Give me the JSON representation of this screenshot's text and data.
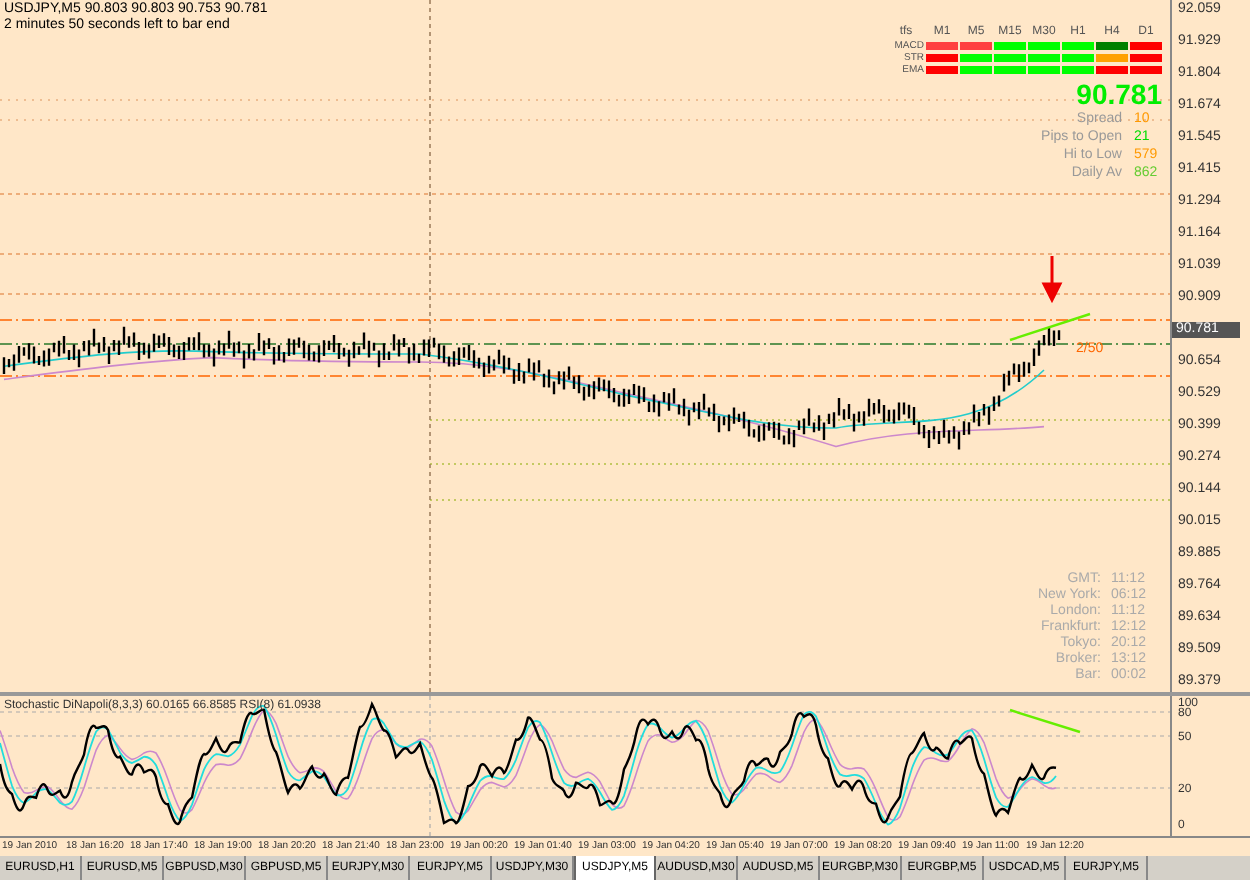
{
  "header": {
    "quote": "USDJPY,M5  90.803 90.803 90.753 90.781",
    "timer": "2 minutes 50 seconds left to bar end"
  },
  "price_axis": {
    "ticks": [
      {
        "label": "92.059",
        "current": false
      },
      {
        "label": "91.929",
        "current": false
      },
      {
        "label": "91.804",
        "current": false
      },
      {
        "label": "91.674",
        "current": false
      },
      {
        "label": "91.545",
        "current": false
      },
      {
        "label": "91.415",
        "current": false
      },
      {
        "label": "91.294",
        "current": false
      },
      {
        "label": "91.164",
        "current": false
      },
      {
        "label": "91.039",
        "current": false
      },
      {
        "label": "90.909",
        "current": false
      },
      {
        "label": "90.781",
        "current": true
      },
      {
        "label": "90.654",
        "current": false
      },
      {
        "label": "90.529",
        "current": false
      },
      {
        "label": "90.399",
        "current": false
      },
      {
        "label": "90.274",
        "current": false
      },
      {
        "label": "90.144",
        "current": false
      },
      {
        "label": "90.015",
        "current": false
      },
      {
        "label": "89.885",
        "current": false
      },
      {
        "label": "89.764",
        "current": false
      },
      {
        "label": "89.634",
        "current": false
      },
      {
        "label": "89.509",
        "current": false
      },
      {
        "label": "89.379",
        "current": false
      }
    ]
  },
  "signal_panel": {
    "corner": "tfs",
    "timeframes": [
      "M1",
      "M5",
      "M15",
      "M30",
      "H1",
      "H4",
      "D1"
    ],
    "rows": [
      {
        "name": "MACD",
        "cells": [
          {
            "color": "#ff4040"
          },
          {
            "color": "#ff4040"
          },
          {
            "color": "#00ff00"
          },
          {
            "color": "#00ff00"
          },
          {
            "color": "#00ff00"
          },
          {
            "color": "#008000"
          },
          {
            "color": "#ff0000"
          }
        ]
      },
      {
        "name": "STR",
        "cells": [
          {
            "color": "#ff0000"
          },
          {
            "color": "#00ff00"
          },
          {
            "color": "#00ff00"
          },
          {
            "color": "#00ff00"
          },
          {
            "color": "#00ff00"
          },
          {
            "color": "#ffa000"
          },
          {
            "color": "#ff0000"
          }
        ]
      },
      {
        "name": "EMA",
        "cells": [
          {
            "color": "#ff0000"
          },
          {
            "color": "#00ff00"
          },
          {
            "color": "#00ff00"
          },
          {
            "color": "#00ff00"
          },
          {
            "color": "#00ff00"
          },
          {
            "color": "#ff0000"
          },
          {
            "color": "#ff0000"
          }
        ]
      }
    ]
  },
  "stats": {
    "price": "90.781",
    "rows": [
      {
        "label": "Spread",
        "value": "10",
        "color": "#ff9900"
      },
      {
        "label": "Pips to Open",
        "value": "21",
        "color": "#00dd00"
      },
      {
        "label": "Hi to Low",
        "value": "579",
        "color": "#ff9900"
      },
      {
        "label": "Daily Av",
        "value": "862",
        "color": "#66cc33"
      }
    ]
  },
  "chart_note": "2/50",
  "clocks": [
    {
      "label": "GMT:",
      "time": "11:12"
    },
    {
      "label": "New York:",
      "time": "06:12"
    },
    {
      "label": "London:",
      "time": "11:12"
    },
    {
      "label": "Frankfurt:",
      "time": "12:12"
    },
    {
      "label": "Tokyo:",
      "time": "20:12"
    },
    {
      "label": "Broker:",
      "time": "13:12"
    },
    {
      "label": "Bar:",
      "time": "00:02"
    }
  ],
  "indicator": {
    "title": "Stochastic DiNapoli(8,3,3) 60.0165 66.8585  RSI(8) 61.0938",
    "ticks": [
      "100",
      "80",
      "50",
      "20",
      "0"
    ]
  },
  "time_axis": [
    "19 Jan 2010",
    "18 Jan 16:20",
    "18 Jan 17:40",
    "18 Jan 19:00",
    "18 Jan 20:20",
    "18 Jan 21:40",
    "18 Jan 23:00",
    "19 Jan 00:20",
    "19 Jan 01:40",
    "19 Jan 03:00",
    "19 Jan 04:20",
    "19 Jan 05:40",
    "19 Jan 07:00",
    "19 Jan 08:20",
    "19 Jan 09:40",
    "19 Jan 11:00",
    "19 Jan 12:20"
  ],
  "tabs": [
    {
      "label": "EURUSD,H1",
      "selected": false
    },
    {
      "label": "EURUSD,M5",
      "selected": false
    },
    {
      "label": "GBPUSD,M30",
      "selected": false
    },
    {
      "label": "GBPUSD,M5",
      "selected": false
    },
    {
      "label": "EURJPY,M30",
      "selected": false
    },
    {
      "label": "EURJPY,M5",
      "selected": false
    },
    {
      "label": "USDJPY,M30",
      "selected": false
    },
    {
      "label": "USDJPY,M5",
      "selected": true
    },
    {
      "label": "AUDUSD,M30",
      "selected": false
    },
    {
      "label": "AUDUSD,M5",
      "selected": false
    },
    {
      "label": "EURGBP,M30",
      "selected": false
    },
    {
      "label": "EURGBP,M5",
      "selected": false
    },
    {
      "label": "USDCAD,M5",
      "selected": false
    },
    {
      "label": "EURJPY,M5",
      "selected": false
    }
  ]
}
